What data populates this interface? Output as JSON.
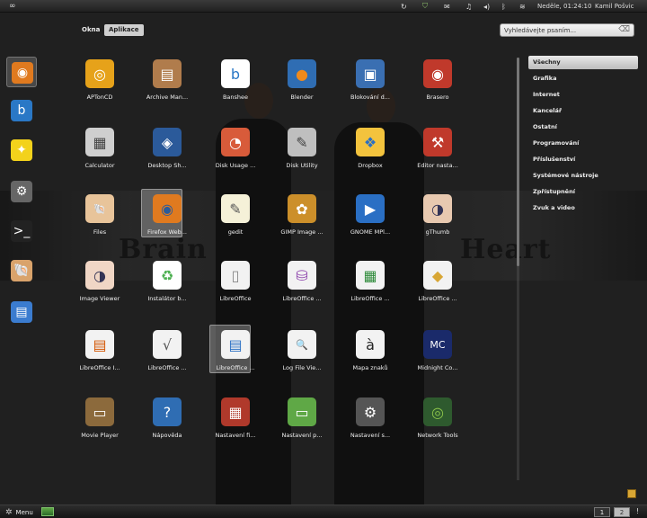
{
  "top_panel": {
    "clock": "Neděle, 01:24:10",
    "user": "Kamil Pošvic"
  },
  "tabs": [
    {
      "label": "Okna",
      "active": false
    },
    {
      "label": "Aplikace",
      "active": true
    }
  ],
  "search": {
    "placeholder": "Vyhledávejte psaním..."
  },
  "background_words": {
    "left": "Brain",
    "right": "Heart"
  },
  "favorites": [
    {
      "name": "firefox-icon",
      "color": "#e07a1f"
    },
    {
      "name": "banshee-icon",
      "color": "#2a78c6"
    },
    {
      "name": "star-icon",
      "color": "#f3d21b"
    },
    {
      "name": "settings-icon",
      "color": "#666666"
    },
    {
      "name": "terminal-icon",
      "color": "#222222"
    },
    {
      "name": "files-icon",
      "color": "#d9a36b"
    },
    {
      "name": "libreoffice-writer-icon",
      "color": "#3b7ccf"
    }
  ],
  "apps": [
    {
      "label": "APTonCD",
      "icon": "aptoncd-icon",
      "color": "#e6a21a",
      "glyph": "◎"
    },
    {
      "label": "Archive Man...",
      "icon": "archive-icon",
      "color": "#b07c4c",
      "glyph": "▤"
    },
    {
      "label": "Banshee",
      "icon": "banshee-icon",
      "color": "#ffffff",
      "glyph": "b",
      "fg": "#2a78c6"
    },
    {
      "label": "Blender",
      "icon": "blender-icon",
      "color": "#2f6db3",
      "glyph": "●",
      "fg": "#f08a1c"
    },
    {
      "label": "Blokování d...",
      "icon": "network-lock-icon",
      "color": "#3a6fb2",
      "glyph": "▣"
    },
    {
      "label": "Brasero",
      "icon": "brasero-icon",
      "color": "#c0392b",
      "glyph": "◉"
    },
    {
      "label": "Calculator",
      "icon": "calculator-icon",
      "color": "#cfcfcf",
      "glyph": "▦",
      "fg": "#444"
    },
    {
      "label": "Desktop Sh...",
      "icon": "desktop-share-icon",
      "color": "#2b5a9a",
      "glyph": "◈"
    },
    {
      "label": "Disk Usage ...",
      "icon": "disk-usage-icon",
      "color": "#d85b3a",
      "glyph": "◔"
    },
    {
      "label": "Disk Utility",
      "icon": "disk-utility-icon",
      "color": "#bfbfbf",
      "glyph": "✎",
      "fg": "#444"
    },
    {
      "label": "Dropbox",
      "icon": "dropbox-icon",
      "color": "#f3c33d",
      "glyph": "❖",
      "fg": "#2a6fc4"
    },
    {
      "label": "Editor nasta...",
      "icon": "config-editor-icon",
      "color": "#c0392b",
      "glyph": "⚒"
    },
    {
      "label": "Files",
      "icon": "files-icon",
      "color": "#e8c49a",
      "glyph": "🐚",
      "fg": "#7a4a1c"
    },
    {
      "label": "Firefox Web...",
      "icon": "firefox-icon",
      "color": "#e07a1f",
      "glyph": "◉",
      "fg": "#2a5b9a"
    },
    {
      "label": "gedit",
      "icon": "gedit-icon",
      "color": "#f5f1d8",
      "glyph": "✎",
      "fg": "#555"
    },
    {
      "label": "GIMP Image ...",
      "icon": "gimp-icon",
      "color": "#cc8f2a",
      "glyph": "✿"
    },
    {
      "label": "GNOME MPl...",
      "icon": "mplayer-icon",
      "color": "#2a6fc4",
      "glyph": "▶"
    },
    {
      "label": "gThumb",
      "icon": "gthumb-icon",
      "color": "#e8c9b0",
      "glyph": "◑",
      "fg": "#335"
    },
    {
      "label": "Image Viewer",
      "icon": "image-viewer-icon",
      "color": "#f0d6c5",
      "glyph": "◑",
      "fg": "#335"
    },
    {
      "label": "Instalátor b...",
      "icon": "installer-icon",
      "color": "#ffffff",
      "glyph": "♻",
      "fg": "#4caf50"
    },
    {
      "label": "LibreOffice",
      "icon": "libreoffice-icon",
      "color": "#f2f2f2",
      "glyph": "▯",
      "fg": "#888"
    },
    {
      "label": "LibreOffice ...",
      "icon": "libreoffice-base-icon",
      "color": "#f2f2f2",
      "glyph": "⛁",
      "fg": "#8e44ad"
    },
    {
      "label": "LibreOffice ...",
      "icon": "libreoffice-calc-icon",
      "color": "#f2f2f2",
      "glyph": "▦",
      "fg": "#2e8b3a"
    },
    {
      "label": "LibreOffice ...",
      "icon": "libreoffice-draw-icon",
      "color": "#f2f2f2",
      "glyph": "◆",
      "fg": "#d8a634"
    },
    {
      "label": "LibreOffice I...",
      "icon": "libreoffice-impress-icon",
      "color": "#f2f2f2",
      "glyph": "▤",
      "fg": "#d35400"
    },
    {
      "label": "LibreOffice ...",
      "icon": "libreoffice-math-icon",
      "color": "#f2f2f2",
      "glyph": "√",
      "fg": "#555"
    },
    {
      "label": "LibreOffice ...",
      "icon": "libreoffice-writer-icon",
      "color": "#f2f2f2",
      "glyph": "▤",
      "fg": "#2a6fc4"
    },
    {
      "label": "Log File Vie...",
      "icon": "log-viewer-icon",
      "color": "#f2f2f2",
      "glyph": "🔍",
      "fg": "#333"
    },
    {
      "label": "Mapa znaků",
      "icon": "charmap-icon",
      "color": "#f2f2f2",
      "glyph": "à",
      "fg": "#222"
    },
    {
      "label": "Midnight Co...",
      "icon": "midnight-commander-icon",
      "color": "#1a2a6a",
      "glyph": "MC"
    },
    {
      "label": "Movie Player",
      "icon": "movie-player-icon",
      "color": "#8c6a3c",
      "glyph": "▭"
    },
    {
      "label": "Nápověda",
      "icon": "help-icon",
      "color": "#2f6db3",
      "glyph": "?"
    },
    {
      "label": "Nastavení fi...",
      "icon": "firewall-icon",
      "color": "#b0392b",
      "glyph": "▦"
    },
    {
      "label": "Nastavení p...",
      "icon": "desktop-settings-icon",
      "color": "#5fa846",
      "glyph": "▭"
    },
    {
      "label": "Nastavení s...",
      "icon": "system-settings-icon",
      "color": "#555555",
      "glyph": "⚙"
    },
    {
      "label": "Network Tools",
      "icon": "network-tools-icon",
      "color": "#2e5a2e",
      "glyph": "◎",
      "fg": "#8bc34a"
    }
  ],
  "categories": [
    {
      "label": "Všechny",
      "active": true
    },
    {
      "label": "Grafika",
      "active": false
    },
    {
      "label": "Internet",
      "active": false
    },
    {
      "label": "Kancelář",
      "active": false
    },
    {
      "label": "Ostatní",
      "active": false
    },
    {
      "label": "Programování",
      "active": false
    },
    {
      "label": "Příslušenství",
      "active": false
    },
    {
      "label": "Systémové nástroje",
      "active": false
    },
    {
      "label": "Zpřístupnění",
      "active": false
    },
    {
      "label": "Zvuk a video",
      "active": false
    }
  ],
  "bottom_panel": {
    "menu_label": "Menu",
    "workspaces": [
      "1",
      "2"
    ]
  }
}
